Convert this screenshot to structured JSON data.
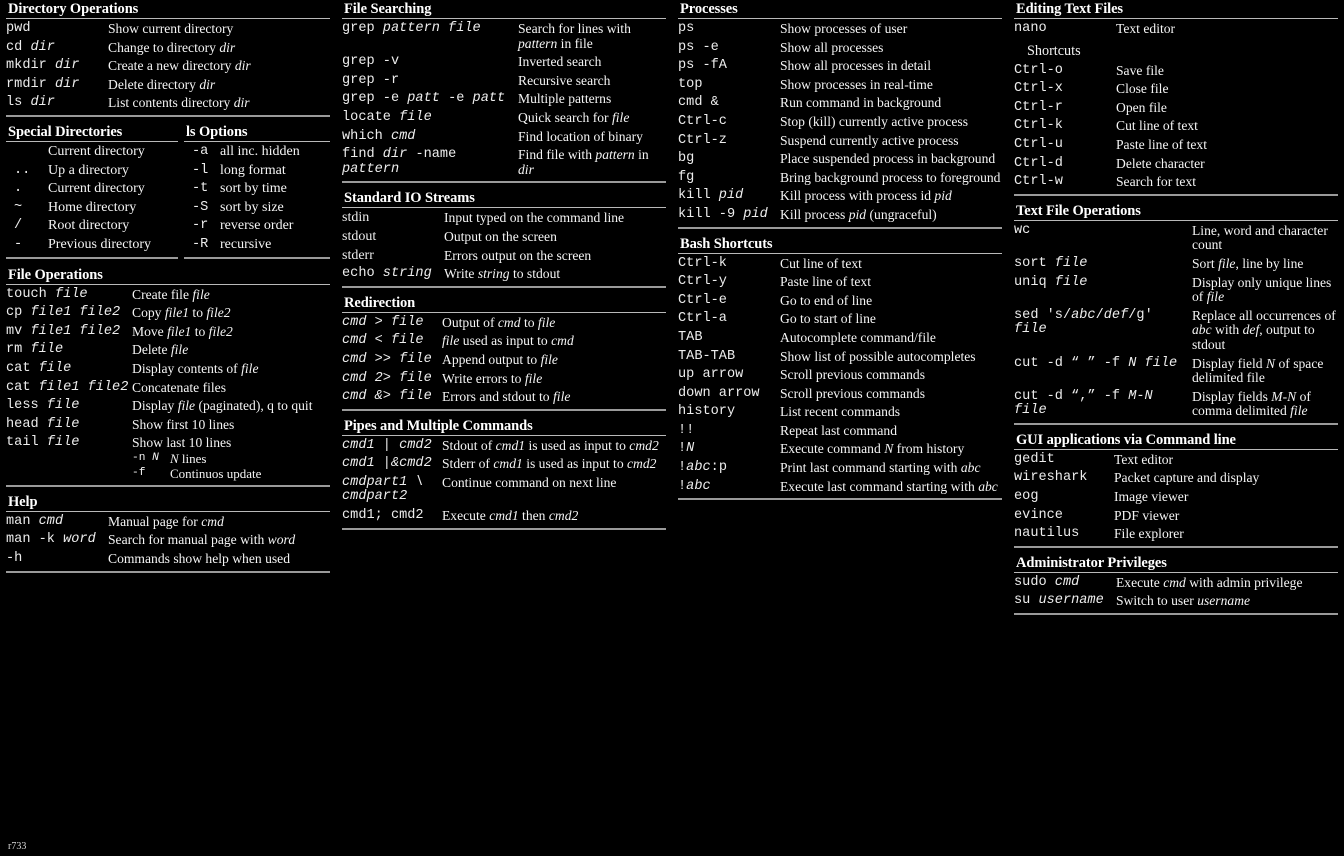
{
  "meta": {
    "revision": "r733"
  },
  "columns": [
    {
      "id": "col1",
      "sections": [
        {
          "id": "directory-operations",
          "title": "Directory Operations",
          "layout": "rows",
          "rows": [
            {
              "cmd": "pwd",
              "cmd_html": "pwd",
              "desc_html": "Show current directory"
            },
            {
              "cmd": "cd dir",
              "cmd_html": "cd <i>dir</i>",
              "desc_html": "Change to directory <i>dir</i>"
            },
            {
              "cmd": "mkdir dir",
              "cmd_html": "mkdir <i>dir</i>",
              "desc_html": "Create a new directory <i>dir</i>"
            },
            {
              "cmd": "rmdir dir",
              "cmd_html": "rmdir <i>dir</i>",
              "desc_html": "Delete directory <i>dir</i>"
            },
            {
              "cmd": "ls dir",
              "cmd_html": "ls <i>dir</i>",
              "desc_html": "List contents directory <i>dir</i>"
            }
          ]
        },
        {
          "id": "special-dirs-and-ls-options",
          "layout": "pair",
          "left": {
            "id": "special-directories",
            "title": "Special Directories",
            "rows": [
              {
                "cmd": "",
                "cmd_html": "",
                "desc_html": "Current directory"
              },
              {
                "cmd": "..",
                "cmd_html": "..",
                "desc_html": "Up a directory"
              },
              {
                "cmd": ".",
                "cmd_html": ".",
                "desc_html": "Current directory"
              },
              {
                "cmd": "~",
                "cmd_html": "~",
                "desc_html": "Home directory"
              },
              {
                "cmd": "/",
                "cmd_html": "/",
                "desc_html": "Root directory"
              },
              {
                "cmd": "-",
                "cmd_html": "-",
                "desc_html": "Previous directory"
              }
            ]
          },
          "right": {
            "id": "ls-options",
            "title": "ls Options",
            "rows": [
              {
                "cmd": "-a",
                "cmd_html": "-a",
                "desc_html": "all inc. hidden"
              },
              {
                "cmd": "-l",
                "cmd_html": "-l",
                "desc_html": "long format"
              },
              {
                "cmd": "-t",
                "cmd_html": "-t",
                "desc_html": "sort by time"
              },
              {
                "cmd": "-S",
                "cmd_html": "-S",
                "desc_html": "sort by size"
              },
              {
                "cmd": "-r",
                "cmd_html": "-r",
                "desc_html": "reverse order"
              },
              {
                "cmd": "-R",
                "cmd_html": "-R",
                "desc_html": "recursive"
              }
            ]
          }
        },
        {
          "id": "file-operations",
          "title": "File Operations",
          "layout": "rows",
          "rows": [
            {
              "cmd": "touch file",
              "cmd_html": "touch <i>file</i>",
              "desc_html": "Create file <i>file</i>"
            },
            {
              "cmd": "cp file1 file2",
              "cmd_html": "cp <i>file1 file2</i>",
              "desc_html": "Copy <i>file1</i> to <i>file2</i>"
            },
            {
              "cmd": "mv file1 file2",
              "cmd_html": "mv <i>file1 file2</i>",
              "desc_html": "Move <i>file1</i> to <i>file2</i>"
            },
            {
              "cmd": "rm file",
              "cmd_html": "rm <i>file</i>",
              "desc_html": "Delete <i>file</i>"
            },
            {
              "cmd": "cat file",
              "cmd_html": "cat <i>file</i>",
              "desc_html": "Display contents of <i>file</i>"
            },
            {
              "cmd": "cat file1 file2",
              "cmd_html": "cat <i>file1 file2</i>",
              "desc_html": "Concatenate files"
            },
            {
              "cmd": "less file",
              "cmd_html": "less <i>file</i>",
              "desc_html": "Display <i>file</i> (paginated), q to quit"
            },
            {
              "cmd": "head file",
              "cmd_html": "head <i>file</i>",
              "desc_html": "Show first 10 lines"
            },
            {
              "cmd": "tail file",
              "cmd_html": "tail <i>file</i>",
              "desc_html": "Show last 10 lines",
              "subrows": [
                {
                  "key": "-n N",
                  "key_html": "-n <i>N</i>",
                  "text_html": "<i>N</i> lines"
                },
                {
                  "key": "-f",
                  "key_html": "-f",
                  "text_html": "Continuos update"
                }
              ]
            }
          ]
        },
        {
          "id": "help",
          "title": "Help",
          "layout": "rows",
          "rows": [
            {
              "cmd": "man cmd",
              "cmd_html": "man <i>cmd</i>",
              "desc_html": "Manual page for <i>cmd</i>"
            },
            {
              "cmd": "man -k word",
              "cmd_html": "man -k <i>word</i>",
              "desc_html": "Search for manual page with <i>word</i>"
            },
            {
              "cmd": "-h",
              "cmd_html": "-h",
              "desc_html": "Commands show help when used"
            }
          ]
        }
      ]
    },
    {
      "id": "col2",
      "sections": [
        {
          "id": "file-searching",
          "title": "File Searching",
          "layout": "rows",
          "rows": [
            {
              "cmd": "grep pattern file",
              "cmd_html": "grep <i>pattern file</i>",
              "desc_html": "Search for lines with <i>pattern</i> in file"
            },
            {
              "cmd": "grep -v",
              "cmd_html": "grep -v",
              "desc_html": "Inverted search"
            },
            {
              "cmd": "grep -r",
              "cmd_html": "grep -r",
              "desc_html": "Recursive search"
            },
            {
              "cmd": "grep -e patt -e patt",
              "cmd_html": "grep -e <i>patt</i> -e <i>patt</i>",
              "desc_html": "Multiple patterns"
            },
            {
              "cmd": "locate file",
              "cmd_html": "locate <i>file</i>",
              "desc_html": "Quick search for <i>file</i>"
            },
            {
              "cmd": "which cmd",
              "cmd_html": "which <i>cmd</i>",
              "desc_html": "Find location of binary"
            },
            {
              "cmd": "find dir -name pattern",
              "cmd_html": "find <i>dir</i> -name <i>pattern</i>",
              "desc_html": "Find file with <i>pattern</i> in <i>dir</i>"
            }
          ]
        },
        {
          "id": "standard-io-streams",
          "title": "Standard IO Streams",
          "layout": "rows",
          "rows": [
            {
              "cmd": "stdin",
              "cmd_html": "stdin",
              "cmd_serif": true,
              "desc_html": "Input typed on the command line"
            },
            {
              "cmd": "stdout",
              "cmd_html": "stdout",
              "cmd_serif": true,
              "desc_html": "Output on the screen"
            },
            {
              "cmd": "stderr",
              "cmd_html": "stderr",
              "cmd_serif": true,
              "desc_html": "Errors output on the screen"
            },
            {
              "cmd": "echo string",
              "cmd_html": "echo <i>string</i>",
              "desc_html": "Write <i>string</i> to stdout"
            }
          ]
        },
        {
          "id": "redirection",
          "title": "Redirection",
          "layout": "rows",
          "italic_cmd": true,
          "rows": [
            {
              "cmd": "cmd > file",
              "cmd_html": "cmd &gt; file",
              "desc_html": "Output of <i>cmd</i> to <i>file</i>"
            },
            {
              "cmd": "cmd < file",
              "cmd_html": "cmd &lt; file",
              "desc_html": "<i>file</i> used as input to <i>cmd</i>"
            },
            {
              "cmd": "cmd >> file",
              "cmd_html": "cmd &gt;&gt; file",
              "desc_html": "Append output to <i>file</i>"
            },
            {
              "cmd": "cmd 2> file",
              "cmd_html": "cmd 2&gt; file",
              "desc_html": "Write errors to <i>file</i>"
            },
            {
              "cmd": "cmd &> file",
              "cmd_html": "cmd &amp;&gt; file",
              "desc_html": "Errors and stdout to <i>file</i>"
            }
          ]
        },
        {
          "id": "pipes-and-multiple-commands",
          "title": "Pipes and Multiple Commands",
          "layout": "rows",
          "italic_cmd": true,
          "rows": [
            {
              "cmd": "cmd1 | cmd2",
              "cmd_html": "cmd1 | cmd2",
              "desc_html": "Stdout of <i>cmd1</i> is used as input to <i>cmd2</i>"
            },
            {
              "cmd": "cmd1 |&cmd2",
              "cmd_html": "cmd1 |&amp;cmd2",
              "desc_html": "Stderr of <i>cmd1</i> is used as input to <i>cmd2</i>"
            },
            {
              "cmd": "cmdpart1 \\ cmdpart2",
              "cmd_html": "cmdpart1 \\<br>cmdpart2",
              "desc_html": "Continue command on next line"
            },
            {
              "cmd": "cmd1; cmd2",
              "cmd_html": "cmd1; cmd2",
              "cmd_upright": true,
              "desc_html": "Execute <i>cmd1</i> then <i>cmd2</i>"
            }
          ]
        }
      ]
    },
    {
      "id": "col3",
      "sections": [
        {
          "id": "processes",
          "title": "Processes",
          "layout": "rows",
          "rows": [
            {
              "cmd": "ps",
              "cmd_html": "ps",
              "desc_html": "Show processes of user"
            },
            {
              "cmd": "ps -e",
              "cmd_html": "ps -e",
              "desc_html": "Show all processes"
            },
            {
              "cmd": "ps -fA",
              "cmd_html": "ps -fA",
              "desc_html": "Show all processes in detail"
            },
            {
              "cmd": "top",
              "cmd_html": "top",
              "desc_html": "Show processes in real-time"
            },
            {
              "cmd": "cmd &",
              "cmd_html": "cmd &amp;",
              "desc_html": "Run command in background"
            },
            {
              "cmd": "Ctrl-c",
              "cmd_html": "Ctrl-c",
              "desc_html": "Stop (kill) currently active process"
            },
            {
              "cmd": "Ctrl-z",
              "cmd_html": "Ctrl-z",
              "desc_html": "Suspend currently active process"
            },
            {
              "cmd": "bg",
              "cmd_html": "bg",
              "desc_html": "Place suspended process in background"
            },
            {
              "cmd": "fg",
              "cmd_html": "fg",
              "desc_html": "Bring background process to foreground"
            },
            {
              "cmd": "kill pid",
              "cmd_html": "kill <i>pid</i>",
              "desc_html": "Kill process with process id <i>pid</i>"
            },
            {
              "cmd": "kill -9 pid",
              "cmd_html": "kill -9 <i>pid</i>",
              "desc_html": "Kill process <i>pid</i> (ungraceful)"
            }
          ]
        },
        {
          "id": "bash-shortcuts",
          "title": "Bash Shortcuts",
          "layout": "rows",
          "rows": [
            {
              "cmd": "Ctrl-k",
              "cmd_html": "Ctrl-k",
              "desc_html": "Cut line of text"
            },
            {
              "cmd": "Ctrl-y",
              "cmd_html": "Ctrl-y",
              "desc_html": "Paste line of text"
            },
            {
              "cmd": "Ctrl-e",
              "cmd_html": "Ctrl-e",
              "desc_html": "Go to end of line"
            },
            {
              "cmd": "Ctrl-a",
              "cmd_html": "Ctrl-a",
              "desc_html": "Go to start of line"
            },
            {
              "cmd": "TAB",
              "cmd_html": "TAB",
              "desc_html": "Autocomplete command/file"
            },
            {
              "cmd": "TAB-TAB",
              "cmd_html": "TAB-TAB",
              "desc_html": "Show list of possible autocompletes"
            },
            {
              "cmd": "up arrow",
              "cmd_html": "up arrow",
              "desc_html": "Scroll previous commands"
            },
            {
              "cmd": "down arrow",
              "cmd_html": "down arrow",
              "desc_html": "Scroll previous commands"
            },
            {
              "cmd": "history",
              "cmd_html": "history",
              "desc_html": "List recent commands"
            },
            {
              "cmd": "!!",
              "cmd_html": "!!",
              "desc_html": "Repeat last command"
            },
            {
              "cmd": "!N",
              "cmd_html": "!<i>N</i>",
              "desc_html": "Execute command <i>N</i> from history"
            },
            {
              "cmd": "!abc:p",
              "cmd_html": "!<i>abc</i>:p",
              "desc_html": "Print last command starting with <i>abc</i>"
            },
            {
              "cmd": "!abc",
              "cmd_html": "!<i>abc</i>",
              "desc_html": "Execute last command starting with <i>abc</i>"
            }
          ]
        }
      ]
    },
    {
      "id": "col4",
      "sections": [
        {
          "id": "editing-text-files",
          "title": "Editing Text Files",
          "layout": "rows",
          "label": "Shortcuts",
          "rows": [
            {
              "cmd": "nano",
              "cmd_html": "nano",
              "desc_html": "Text editor"
            }
          ],
          "rows_after_label": [
            {
              "cmd": "Ctrl-o",
              "cmd_html": "Ctrl-o",
              "desc_html": "Save file"
            },
            {
              "cmd": "Ctrl-x",
              "cmd_html": "Ctrl-x",
              "desc_html": "Close file"
            },
            {
              "cmd": "Ctrl-r",
              "cmd_html": "Ctrl-r",
              "desc_html": "Open file"
            },
            {
              "cmd": "Ctrl-k",
              "cmd_html": "Ctrl-k",
              "desc_html": "Cut line of text"
            },
            {
              "cmd": "Ctrl-u",
              "cmd_html": "Ctrl-u",
              "desc_html": "Paste line of text"
            },
            {
              "cmd": "Ctrl-d",
              "cmd_html": "Ctrl-d",
              "desc_html": "Delete character"
            },
            {
              "cmd": "Ctrl-w",
              "cmd_html": "Ctrl-w",
              "desc_html": "Search for text"
            }
          ]
        },
        {
          "id": "text-file-operations",
          "title": "Text File Operations",
          "layout": "rows",
          "rows": [
            {
              "cmd": "wc",
              "cmd_html": "wc",
              "desc_html": "Line, word and character count"
            },
            {
              "cmd": "sort file",
              "cmd_html": "sort <i>file</i>",
              "desc_html": "Sort <i>file</i>, line by line"
            },
            {
              "cmd": "uniq file",
              "cmd_html": "uniq <i>file</i>",
              "desc_html": "Display only unique lines of <i>file</i>"
            },
            {
              "cmd": "sed 's/abc/def/g' file",
              "cmd_html": "sed 's/<i>abc</i>/<i>def</i>/g' <i>file</i>",
              "desc_html": "Replace all occurrences of <i>abc</i> with <i>def</i>, output to stdout"
            },
            {
              "cmd": "cut -d \" \" -f N file",
              "cmd_html": "cut -d “ ” -f <i>N file</i>",
              "desc_html": "Display field <i>N</i> of space delimited file"
            },
            {
              "cmd": "cut -d \",\" -f M-N file",
              "cmd_html": "cut -d “,” -f <i>M-N file</i>",
              "desc_html": "Display fields <i>M-N</i> of comma delimited <i>file</i>"
            }
          ]
        },
        {
          "id": "gui-applications-via-command-line",
          "title": "GUI applications via Command line",
          "layout": "rows",
          "rows": [
            {
              "cmd": "gedit",
              "cmd_html": "gedit",
              "desc_html": "Text editor"
            },
            {
              "cmd": "wireshark",
              "cmd_html": "wireshark",
              "desc_html": "Packet capture and display"
            },
            {
              "cmd": "eog",
              "cmd_html": "eog",
              "desc_html": "Image viewer"
            },
            {
              "cmd": "evince",
              "cmd_html": "evince",
              "desc_html": "PDF viewer"
            },
            {
              "cmd": "nautilus",
              "cmd_html": "nautilus",
              "desc_html": "File explorer"
            }
          ]
        },
        {
          "id": "administrator-privileges",
          "title": "Administrator Privileges",
          "layout": "rows",
          "rows": [
            {
              "cmd": "sudo cmd",
              "cmd_html": "sudo <i>cmd</i>",
              "desc_html": "Execute <i>cmd</i> with admin privilege"
            },
            {
              "cmd": "su username",
              "cmd_html": "su <i>username</i>",
              "desc_html": "Switch to user <i>username</i>"
            }
          ]
        }
      ]
    }
  ]
}
